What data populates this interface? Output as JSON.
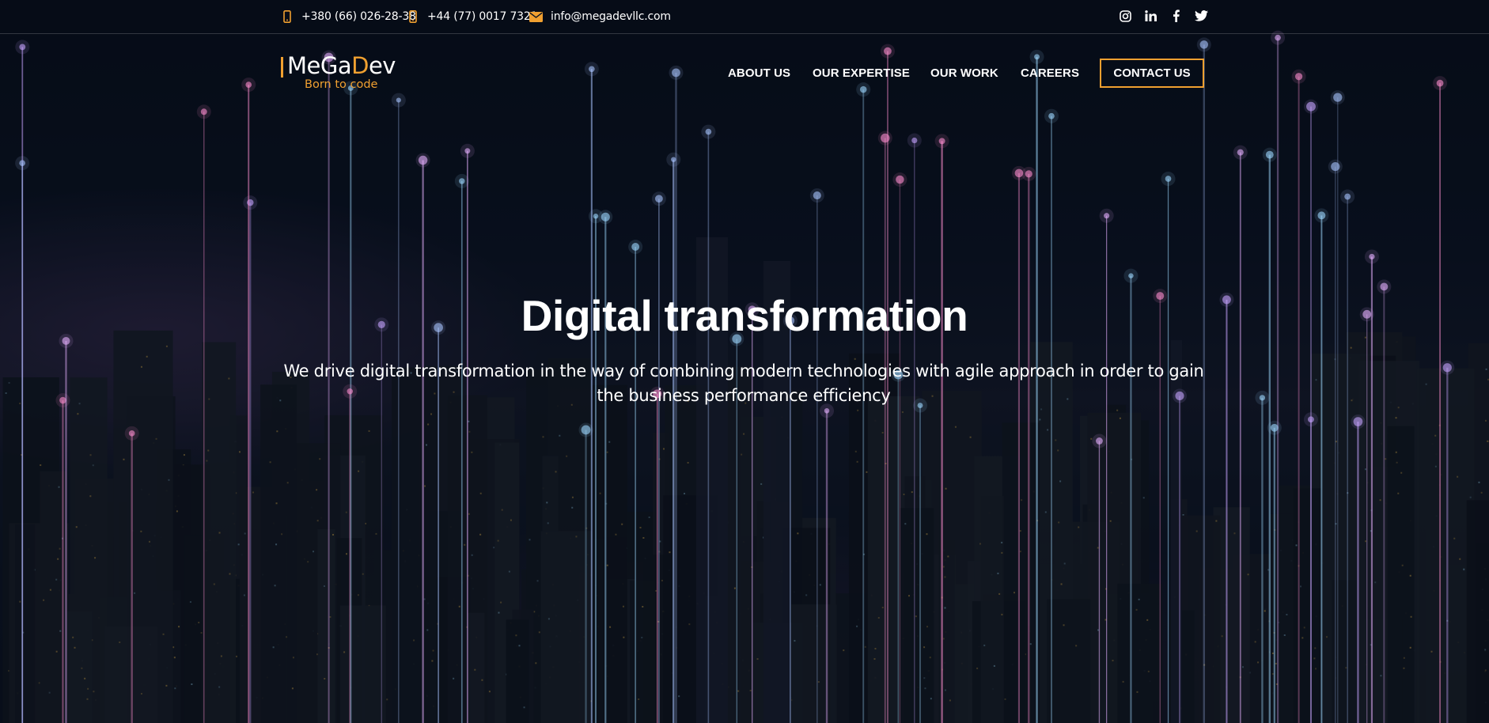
{
  "topbar": {
    "contacts": [
      {
        "icon": "phone-icon",
        "text": "+380 (66) 026-28-38"
      },
      {
        "icon": "phone-icon",
        "text": "+44 (77) 0017 7321"
      },
      {
        "icon": "envelope-icon",
        "text": "info@megadevllc.com"
      }
    ],
    "socials": [
      "instagram-icon",
      "linkedin-icon",
      "facebook-icon",
      "twitter-icon"
    ]
  },
  "logo": {
    "name_prefix": "MeGa",
    "name_d": "D",
    "name_suffix": "ev",
    "tagline": "Born to code"
  },
  "nav": {
    "items": [
      "ABOUT US",
      "OUR EXPERTISE",
      "OUR WORK",
      "CAREERS"
    ],
    "cta": "CONTACT US"
  },
  "hero": {
    "title": "Digital transformation",
    "subtitle": "We drive digital transformation in the way of combining modern technologies with agile approach in order to gain the business performance efficiency"
  },
  "colors": {
    "accent": "#f0a030",
    "background": "#070d18",
    "text": "#ffffff"
  }
}
